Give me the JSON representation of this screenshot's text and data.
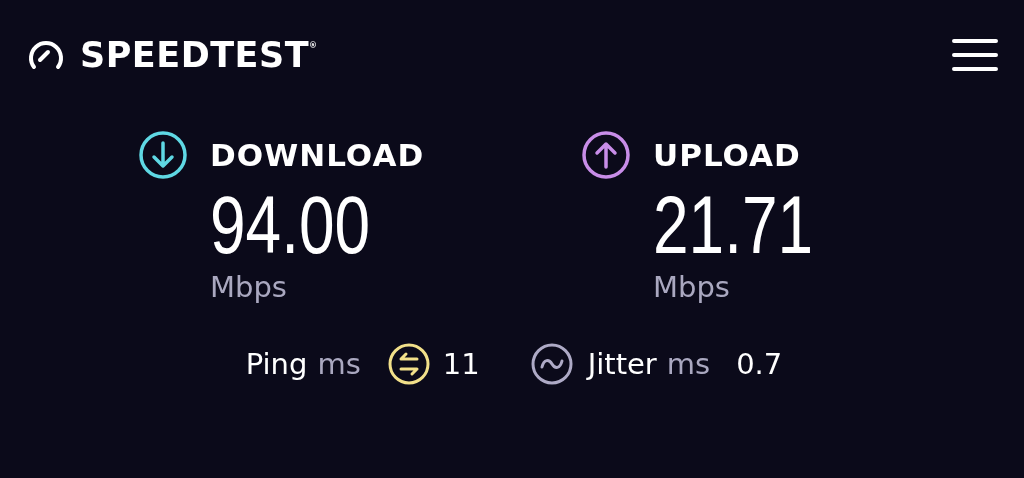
{
  "header": {
    "logo": "SPEEDTEST$^{®}$"
  },
  "metrics": [
    {
      "kind": "download",
      "label": "DOWNLOAD",
      "value": "94.00",
      "unit": "Mbps",
      "color": "#5fd8e4"
    },
    {
      "kind": "upload",
      "label": "UPLOAD",
      "value": "21.71",
      "unit": "Mbps",
      "color": "#c88de8"
    }
  ],
  "stats": [
    {
      "kind": "ping",
      "label": "Ping",
      "unit": "ms",
      "value": "11",
      "color": "#f2e08a"
    },
    {
      "kind": "jitter",
      "label": "Jitter",
      "unit": "ms",
      "value": "0.7",
      "color": "#aeaac6"
    }
  ]
}
